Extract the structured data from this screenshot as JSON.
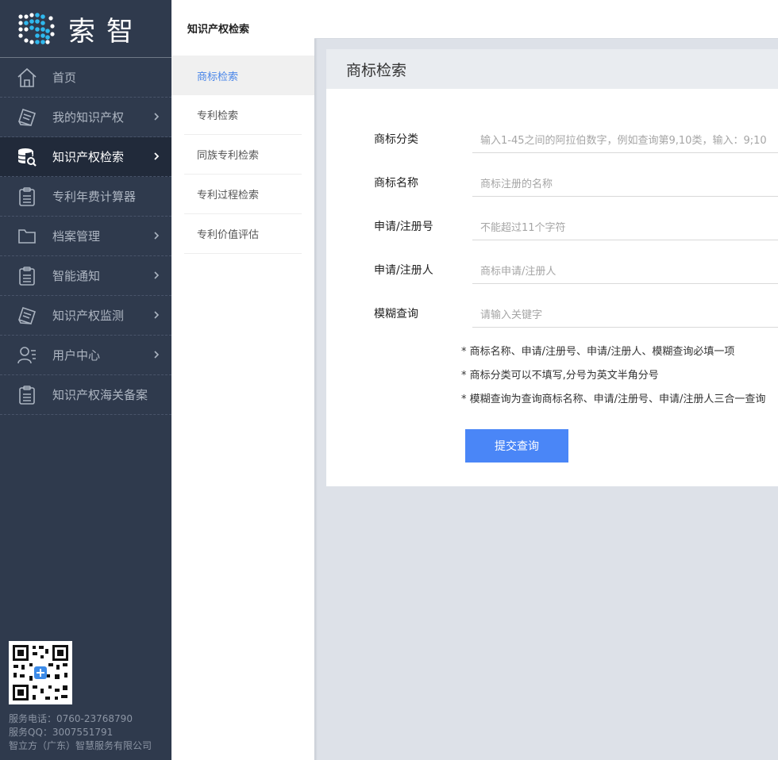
{
  "brand": {
    "logo_text": "索智"
  },
  "sidebar": {
    "items": [
      {
        "label": "首页",
        "icon": "home-icon"
      },
      {
        "label": "我的知识产权",
        "icon": "document-stack-icon"
      },
      {
        "label": "知识产权检索",
        "icon": "database-search-icon",
        "active": true
      },
      {
        "label": "专利年费计算器",
        "icon": "clipboard-icon"
      },
      {
        "label": "档案管理",
        "icon": "folder-icon"
      },
      {
        "label": "智能通知",
        "icon": "clipboard-icon"
      },
      {
        "label": "知识产权监测",
        "icon": "document-stack-icon"
      },
      {
        "label": "用户中心",
        "icon": "user-list-icon"
      },
      {
        "label": "知识产权海关备案",
        "icon": "clipboard-icon"
      }
    ],
    "contact": {
      "phone": "服务电话：0760-23768790",
      "qq": "服务QQ：3007551791",
      "company": "智立方（广东）智慧服务有限公司"
    }
  },
  "submenu": {
    "title": "知识产权检索",
    "items": [
      {
        "label": "商标检索",
        "active": true
      },
      {
        "label": "专利检索"
      },
      {
        "label": "同族专利检索"
      },
      {
        "label": "专利过程检索"
      },
      {
        "label": "专利价值评估"
      }
    ]
  },
  "panel": {
    "title": "商标检索",
    "fields": [
      {
        "label": "商标分类",
        "placeholder": "输入1-45之间的阿拉伯数字，例如查询第9,10类，输入：9;10"
      },
      {
        "label": "商标名称",
        "placeholder": "商标注册的名称"
      },
      {
        "label": "申请/注册号",
        "placeholder": "不能超过11个字符"
      },
      {
        "label": "申请/注册人",
        "placeholder": "商标申请/注册人"
      },
      {
        "label": "模糊查询",
        "placeholder": "请输入关键字"
      }
    ],
    "notes": [
      "* 商标名称、申请/注册号、申请/注册人、模糊查询必填一项",
      "* 商标分类可以不填写,分号为英文半角分号",
      "* 模糊查询为查询商标名称、申请/注册号、申请/注册人三合一查询"
    ],
    "submit_label": "提交查询"
  },
  "colors": {
    "sidebar_bg": "#2f3a4d",
    "sidebar_active": "#212a3a",
    "accent": "#4a86f7",
    "submenu_active_text": "#4a86e8"
  }
}
